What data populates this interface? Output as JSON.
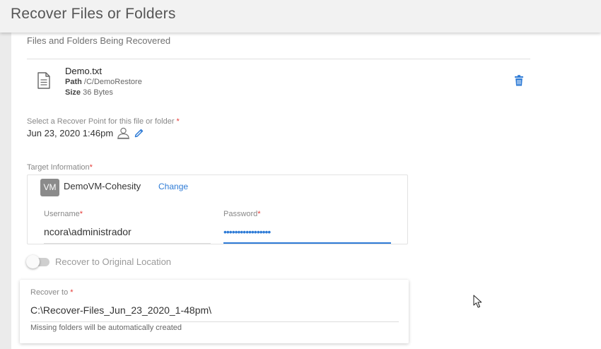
{
  "header": {
    "title": "Recover Files or Folders"
  },
  "section": {
    "title": "Files and Folders Being Recovered"
  },
  "file": {
    "icon": "document-icon",
    "name": "Demo.txt",
    "path_label": "Path",
    "path_value": "/C/DemoRestore",
    "size_label": "Size",
    "size_value": "36 Bytes",
    "delete_icon": "trash-icon"
  },
  "recover_point": {
    "label": "Select a Recover Point for this file or folder",
    "required_mark": "*",
    "value": "Jun 23, 2020 1:46pm",
    "icons": [
      "user-restore-icon",
      "pencil-icon"
    ]
  },
  "target": {
    "label": "Target Information",
    "required_mark": "*",
    "vm_badge": "VM",
    "vm_name": "DemoVM-Cohesity",
    "change_label": "Change",
    "username_label": "Username",
    "username_value": "ncora\\administrador",
    "password_label": "Password",
    "password_value": "•••••••••••••••••"
  },
  "toggle": {
    "label": "Recover to Original Location",
    "checked": false
  },
  "recover_to": {
    "label": "Recover to",
    "required_mark": "*",
    "value": "C:\\Recover-Files_Jun_23_2020_1-48pm\\",
    "hint": "Missing folders will be automatically created"
  },
  "colors": {
    "accent": "#2e7bd6",
    "required": "#e53935",
    "vm_badge": "#8b8b8b"
  }
}
